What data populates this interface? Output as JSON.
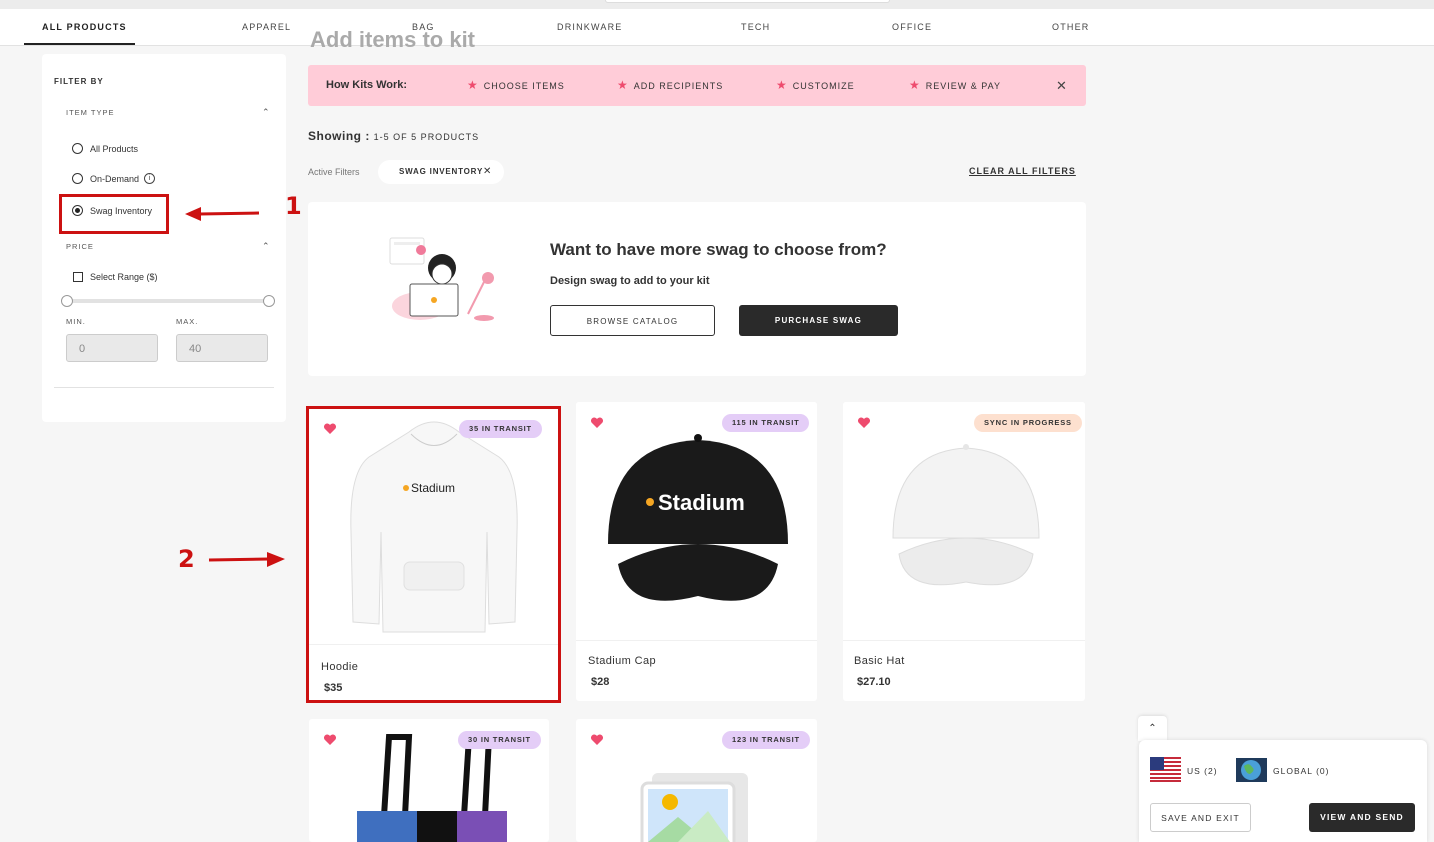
{
  "tabs": [
    {
      "label": "ALL PRODUCTS",
      "active": true
    },
    {
      "label": "APPAREL"
    },
    {
      "label": "BAG"
    },
    {
      "label": "DRINKWARE"
    },
    {
      "label": "TECH"
    },
    {
      "label": "OFFICE"
    },
    {
      "label": "OTHER"
    }
  ],
  "sidebar": {
    "filter_by": "FILTER BY",
    "item_type": {
      "label": "ITEM TYPE",
      "options": [
        "All Products",
        "On-Demand",
        "Swag Inventory"
      ],
      "selected": "Swag Inventory"
    },
    "price": {
      "label": "PRICE",
      "select_range": "Select Range ($)",
      "min_label": "MIN.",
      "max_label": "MAX.",
      "min_value": "0",
      "max_value": "40"
    }
  },
  "annotations": {
    "one": "1",
    "two": "2"
  },
  "heading_partial": "Add items to kit",
  "how_kits": {
    "title": "How Kits Work:",
    "steps": [
      "CHOOSE ITEMS",
      "ADD RECIPIENTS",
      "CUSTOMIZE",
      "REVIEW & PAY"
    ]
  },
  "showing": {
    "label": "Showing :",
    "count": "1-5 OF 5 PRODUCTS"
  },
  "active_filters": {
    "label": "Active Filters",
    "chip": "SWAG INVENTORY",
    "clear_all": "CLEAR ALL FILTERS"
  },
  "promo": {
    "title": "Want to have more swag to choose from?",
    "subtitle": "Design swag to add to your kit",
    "browse": "BROWSE CATALOG",
    "purchase": "PURCHASE SWAG"
  },
  "products": [
    {
      "name": "Hoodie",
      "price": "$35",
      "badge": "35 IN TRANSIT",
      "logo": "Stadium"
    },
    {
      "name": "Stadium Cap",
      "price": "$28",
      "badge": "115 IN TRANSIT",
      "logo": "Stadium"
    },
    {
      "name": "Basic Hat",
      "price": "$27.10",
      "badge": "SYNC IN PROGRESS"
    },
    {
      "badge": "30 IN TRANSIT"
    },
    {
      "badge": "123 IN TRANSIT"
    }
  ],
  "bottom_panel": {
    "us": "US (2)",
    "global": "GLOBAL (0)",
    "save": "SAVE AND EXIT",
    "send": "VIEW AND SEND"
  },
  "colors": {
    "accent_pink": "#ffccd8",
    "star": "#ee4b6e",
    "transit_badge": "#e4cdf7",
    "sync_badge": "#fde0cf",
    "annotation_red": "#cc1111"
  }
}
